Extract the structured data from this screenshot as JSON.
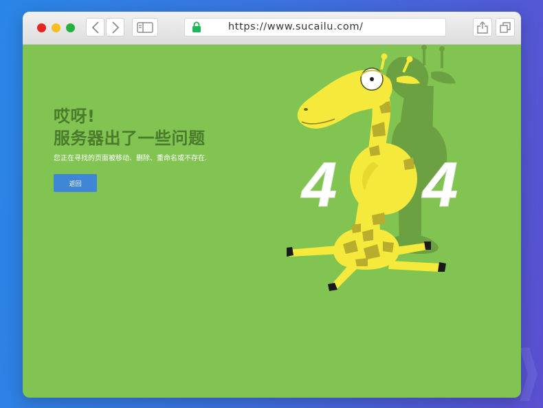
{
  "browser": {
    "url": "https://www.sucailu.com/",
    "icons": [
      "back-arrow-icon",
      "forward-arrow-icon",
      "sidebar-icon",
      "lock-icon",
      "share-icon",
      "tabs-icon"
    ]
  },
  "error_page": {
    "heading_line1": "哎呀!",
    "heading_line2": "服务器出了一些问题",
    "description": "您正在寻找的页面被移动、删除、重命名或不存在.",
    "return_button": "返回",
    "digit_left": "4",
    "digit_right": "4"
  },
  "colors": {
    "background": "#82c451",
    "heading": "#4a7a2c",
    "button": "#3f86d6",
    "giraffe": "#f5ea3c",
    "spots": "#b9ad2e",
    "shadow": "#6ca141"
  }
}
